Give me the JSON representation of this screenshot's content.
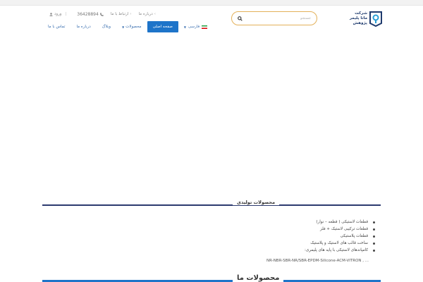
{
  "logo": {
    "text_line1": "شرکت",
    "text_line2": "ماتا پلیمر",
    "text_line3": "پژوهش"
  },
  "search": {
    "placeholder": "جستجو"
  },
  "top_nav": {
    "about": "درباره ما",
    "contact": "ارتباط با ما",
    "phone": "36428894",
    "login": "ورود"
  },
  "main_nav": {
    "language": "فارسی",
    "home": "صفحه اصلی",
    "products": "محصولات",
    "blog": "وبلاگ",
    "about": "درباره ما",
    "contact": "تماس با ما"
  },
  "section1": {
    "title": "محصولات تولیدی",
    "items": [
      "قطعات لاستیکی ( قطعه – نوار)",
      "قطعات ترکیبی لاستیک + فلز",
      "قطعات پلاستیکی",
      "ساخت قالب های لاستیک و پلاستیک",
      "کامپاندهای لاستیکی با پایه های پلیمری:"
    ],
    "materials": "NR-NBR-SBR-NR/SBR-EPDM-Silicone-ACM-VITRON , ..."
  },
  "section2": {
    "title": "محصولات ما"
  },
  "colors": {
    "accent": "#1e74c9",
    "search_border": "#e3b15a",
    "divider": "#2c3a6f"
  }
}
